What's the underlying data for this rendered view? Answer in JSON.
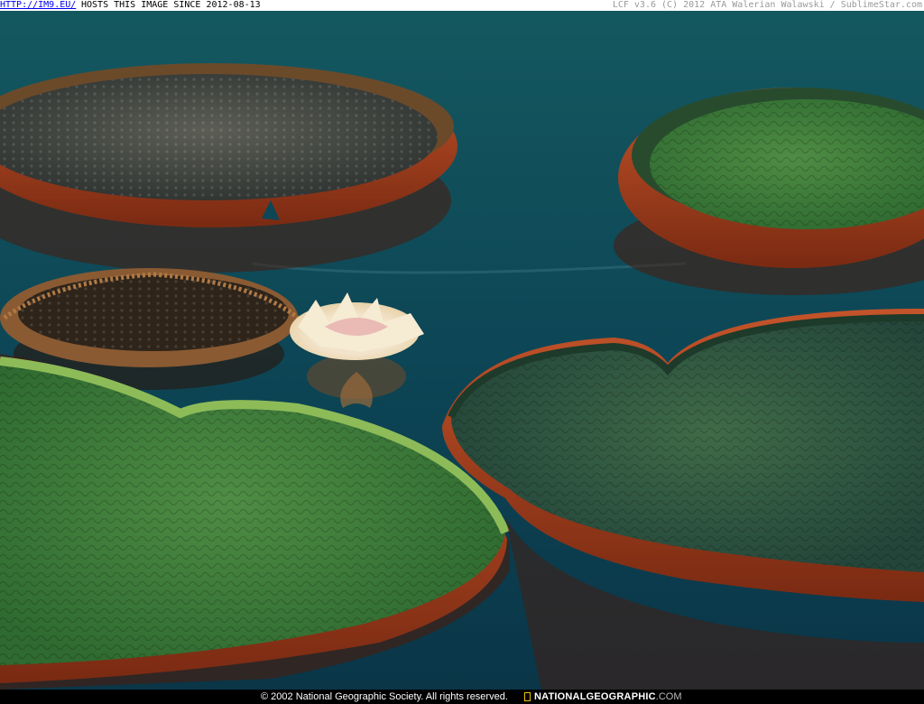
{
  "header": {
    "link_text": "HTTP://IM9.EU/",
    "hosts_text": "HOSTS THIS IMAGE SINCE 2012-08-13",
    "credit_text": "LCF v3.6 (C) 2012 ATA Walerian Walawski / SublimeStar.com"
  },
  "footer": {
    "copyright": "© 2002 National Geographic Society. All rights reserved.",
    "brand": "NATIONALGEOGRAPHIC",
    "brand_domain": ".COM"
  },
  "colors": {
    "water": "#0e4f5a",
    "pad_green": "#3f7d3a",
    "pad_rim_red": "#b0401f",
    "brand_yellow": "#f2c200"
  }
}
